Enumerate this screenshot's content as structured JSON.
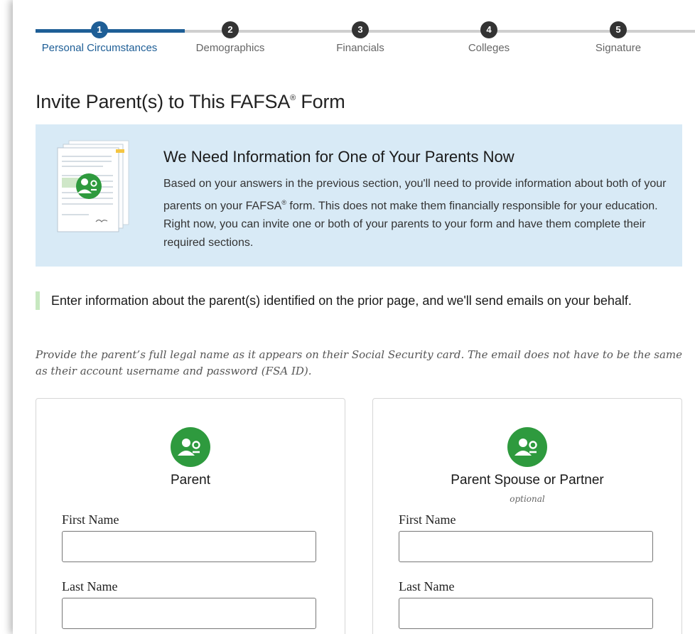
{
  "stepper": {
    "steps": [
      {
        "num": "1",
        "label": "Personal Circumstances"
      },
      {
        "num": "2",
        "label": "Demographics"
      },
      {
        "num": "3",
        "label": "Financials"
      },
      {
        "num": "4",
        "label": "Colleges"
      },
      {
        "num": "5",
        "label": "Signature"
      }
    ],
    "active_step": 1
  },
  "page": {
    "title": "Invite Parent(s) to This FAFSA",
    "title_mark": "®",
    "title_suffix": " Form"
  },
  "banner": {
    "heading": "We Need Information for One of Your Parents Now",
    "body_1": "Based on your answers in the previous section, you'll need to provide information about both of your parents on your FAFSA",
    "body_mark": "®",
    "body_2": " form. This does not make them financially responsible for your education. Right now, you can invite one or both of your parents to your form and have them complete their required sections."
  },
  "callout": "Enter information about the parent(s) identified on the prior page, and we'll send emails on your behalf.",
  "helper": "Provide the parent’s full legal name as it appears on their Social Security card. The email does not have to be the same as their account username and password (FSA ID).",
  "cards": [
    {
      "title": "Parent",
      "subtitle": "",
      "first_label": "First Name",
      "first_value": "",
      "last_label": "Last Name",
      "last_value": ""
    },
    {
      "title": "Parent Spouse or Partner",
      "subtitle": "optional",
      "first_label": "First Name",
      "first_value": "",
      "last_label": "Last Name",
      "last_value": ""
    }
  ],
  "colors": {
    "accent": "#1e5e96",
    "inactive_step": "#333333",
    "banner_bg": "#d8eaf6",
    "callout_border": "#c7e8c0",
    "avatar_green": "#2e9a3e"
  },
  "icons": {
    "banner": "document-with-person-icon",
    "card": "person-add-icon"
  }
}
